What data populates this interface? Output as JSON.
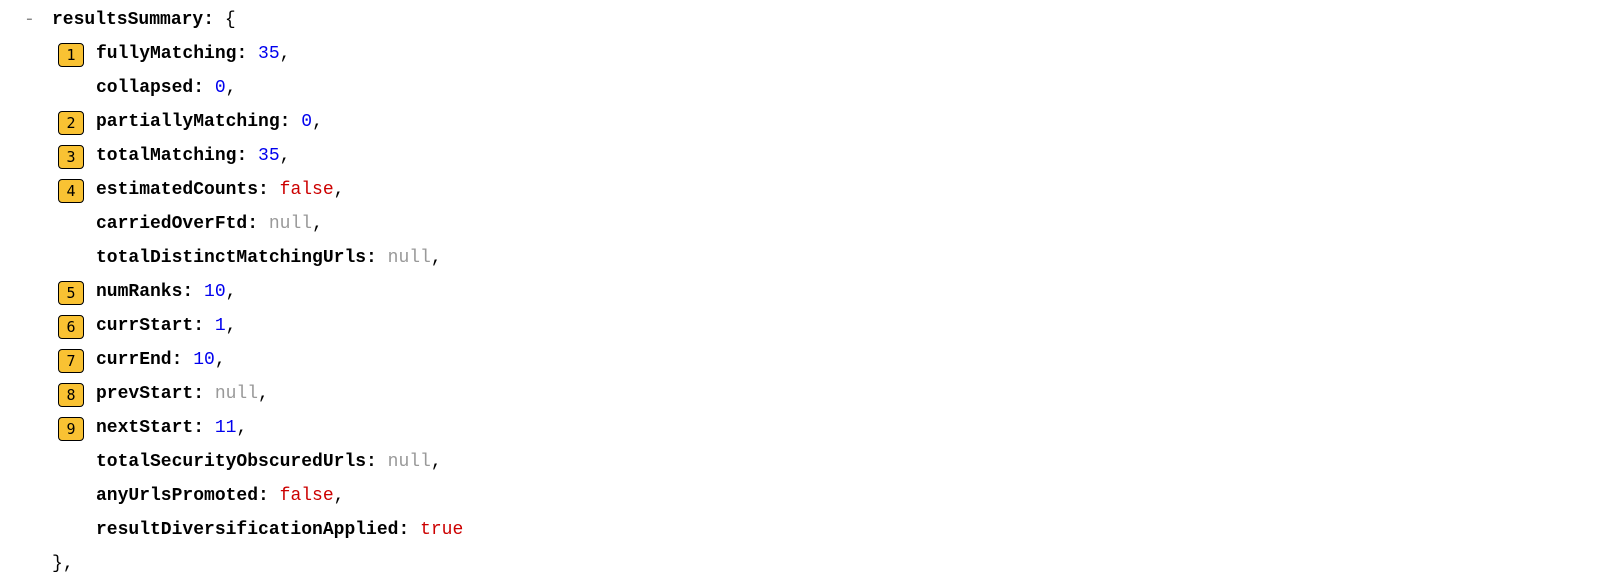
{
  "toggle": "-",
  "rootKey": "resultsSummary",
  "openBrace": "{",
  "closeBrace": "}",
  "entries": [
    {
      "badge": "1",
      "key": "fullyMatching",
      "value": "35",
      "type": "number",
      "trailingComma": true
    },
    {
      "badge": "",
      "key": "collapsed",
      "value": "0",
      "type": "number",
      "trailingComma": true
    },
    {
      "badge": "2",
      "key": "partiallyMatching",
      "value": "0",
      "type": "number",
      "trailingComma": true
    },
    {
      "badge": "3",
      "key": "totalMatching",
      "value": "35",
      "type": "number",
      "trailingComma": true
    },
    {
      "badge": "4",
      "key": "estimatedCounts",
      "value": "false",
      "type": "bool",
      "trailingComma": true
    },
    {
      "badge": "",
      "key": "carriedOverFtd",
      "value": "null",
      "type": "null",
      "trailingComma": true
    },
    {
      "badge": "",
      "key": "totalDistinctMatchingUrls",
      "value": "null",
      "type": "null",
      "trailingComma": true
    },
    {
      "badge": "5",
      "key": "numRanks",
      "value": "10",
      "type": "number",
      "trailingComma": true
    },
    {
      "badge": "6",
      "key": "currStart",
      "value": "1",
      "type": "number",
      "trailingComma": true
    },
    {
      "badge": "7",
      "key": "currEnd",
      "value": "10",
      "type": "number",
      "trailingComma": true
    },
    {
      "badge": "8",
      "key": "prevStart",
      "value": "null",
      "type": "null",
      "trailingComma": true
    },
    {
      "badge": "9",
      "key": "nextStart",
      "value": "11",
      "type": "number",
      "trailingComma": true
    },
    {
      "badge": "",
      "key": "totalSecurityObscuredUrls",
      "value": "null",
      "type": "null",
      "trailingComma": true
    },
    {
      "badge": "",
      "key": "anyUrlsPromoted",
      "value": "false",
      "type": "bool",
      "trailingComma": true
    },
    {
      "badge": "",
      "key": "resultDiversificationApplied",
      "value": "true",
      "type": "bool",
      "trailingComma": false
    }
  ],
  "closingComma": ","
}
